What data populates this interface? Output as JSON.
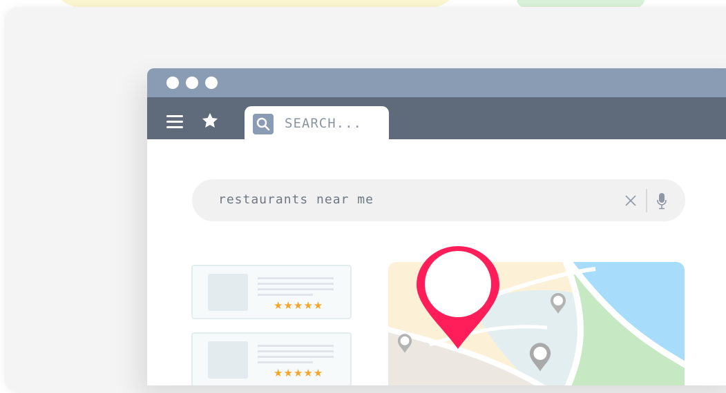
{
  "browser": {
    "tab": {
      "search_label": "SEARCH...",
      "search_icon": "search-icon"
    },
    "toolbar": {
      "menu_icon": "hamburger-menu-icon",
      "bookmark_icon": "star-icon"
    },
    "window_controls": [
      "dot",
      "dot",
      "dot"
    ]
  },
  "search": {
    "query": "restaurants near me",
    "clear_icon": "close-icon",
    "voice_icon": "microphone-icon"
  },
  "results": [
    {
      "rating": 5,
      "stars": "★★★★★"
    },
    {
      "rating": 5,
      "stars": "★★★★★"
    }
  ],
  "map": {
    "main_pin_color": "#ff1e5a",
    "secondary_pin_color": "#a9a9a9",
    "zones": [
      "#fcf1d7",
      "#e3eef0",
      "#a8dcfb",
      "#c6e9c3",
      "#ede7e1"
    ]
  },
  "colors": {
    "titlebar": "#8a9cb3",
    "toolbar": "#5f6b7a",
    "star_rating": "#f4a52a"
  }
}
